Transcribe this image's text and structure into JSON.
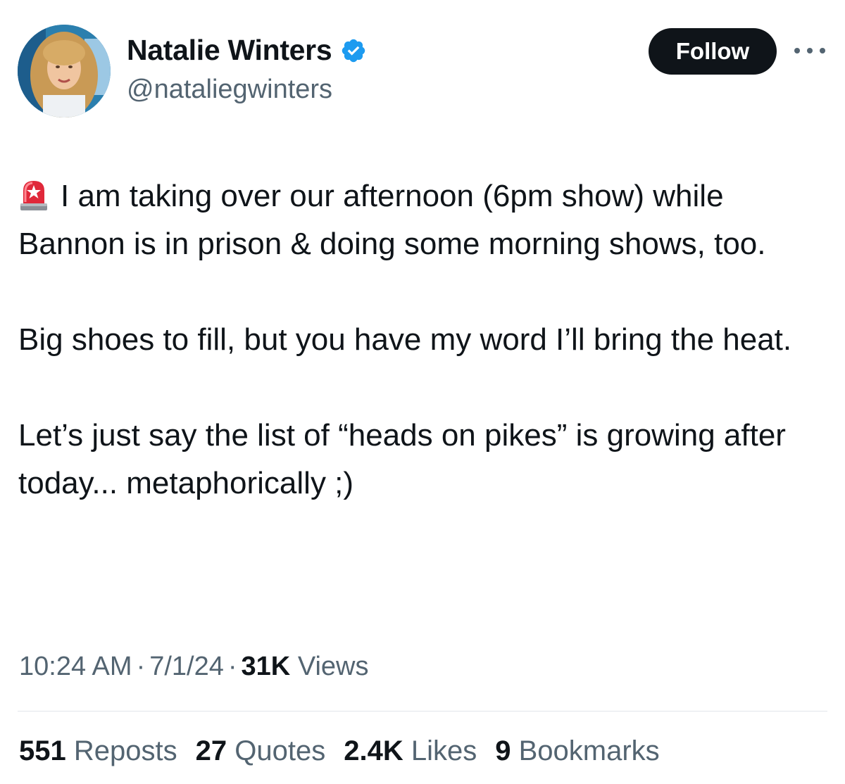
{
  "author": {
    "display_name": "Natalie Winters",
    "handle": "@nataliegwinters",
    "verified_icon": "verified-badge-icon",
    "avatar_icon": "profile-photo"
  },
  "actions": {
    "follow_label": "Follow",
    "more_icon": "more-horizontal-icon"
  },
  "tweet": {
    "paragraphs": [
      "I am taking over our afternoon (6pm show) while Bannon is in prison & doing some morning shows, too.",
      "Big shoes to fill, but you have my word I’ll bring the heat.",
      "Let’s just say the list of “heads on pikes” is growing after today... metaphorically ;)"
    ],
    "leading_emoji": "siren-icon"
  },
  "meta": {
    "time": "10:24 AM",
    "date": "7/1/24",
    "views_count": "31K",
    "views_label": "Views",
    "separator": "·"
  },
  "stats": [
    {
      "count": "551",
      "label": "Reposts"
    },
    {
      "count": "27",
      "label": "Quotes"
    },
    {
      "count": "2.4K",
      "label": "Likes"
    },
    {
      "count": "9",
      "label": "Bookmarks"
    }
  ],
  "colors": {
    "text_primary": "#0f1419",
    "text_secondary": "#536471",
    "verified_blue": "#1d9bf0",
    "follow_bg": "#0f1419",
    "divider": "#e1e6ea"
  }
}
